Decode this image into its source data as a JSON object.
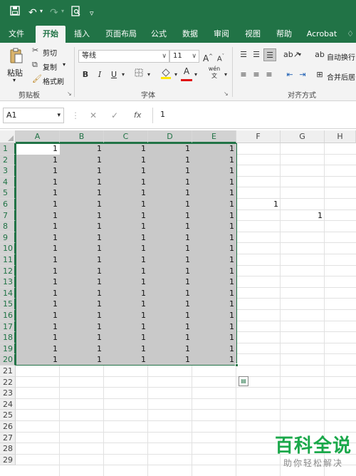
{
  "title_bar": {
    "quick_access": [
      "save-icon",
      "undo-icon",
      "redo-icon",
      "print-preview-icon",
      "customize-icon"
    ]
  },
  "tabs": [
    "文件",
    "开始",
    "插入",
    "页面布局",
    "公式",
    "数据",
    "审阅",
    "视图",
    "帮助",
    "Acrobat"
  ],
  "active_tab": "开始",
  "clipboard": {
    "paste": "粘贴",
    "cut": "剪切",
    "copy": "复制",
    "format_painter": "格式刷",
    "label": "剪贴板"
  },
  "font": {
    "family": "等线",
    "size": "11",
    "grow": "A",
    "shrink": "A",
    "bold": "B",
    "italic": "I",
    "underline": "U",
    "color_letter": "A",
    "phonetic": "wén",
    "label": "字体"
  },
  "alignment": {
    "wrap_text": "自动换行",
    "merge_center": "合并后居",
    "label": "对齐方式"
  },
  "formula_bar": {
    "name_box": "A1",
    "fx": "fx",
    "value": "1"
  },
  "grid": {
    "columns": [
      "A",
      "B",
      "C",
      "D",
      "E",
      "F",
      "G",
      "H"
    ],
    "rows": [
      "1",
      "2",
      "3",
      "4",
      "5",
      "6",
      "7",
      "8",
      "9",
      "10",
      "11",
      "12",
      "13",
      "14",
      "15",
      "16",
      "17",
      "18",
      "19",
      "20",
      "21",
      "22",
      "23",
      "24",
      "25",
      "26",
      "27",
      "28",
      "29"
    ],
    "block_value": "1",
    "selected_range": "A1:E20",
    "extra_cells": [
      {
        "cell": "F6",
        "value": "1"
      },
      {
        "cell": "G7",
        "value": "1"
      }
    ],
    "selection_fill_color": "#c9c9c9",
    "accent_color": "#217346"
  },
  "watermark": {
    "main": "百科全说",
    "sub": "助你轻松解决"
  }
}
